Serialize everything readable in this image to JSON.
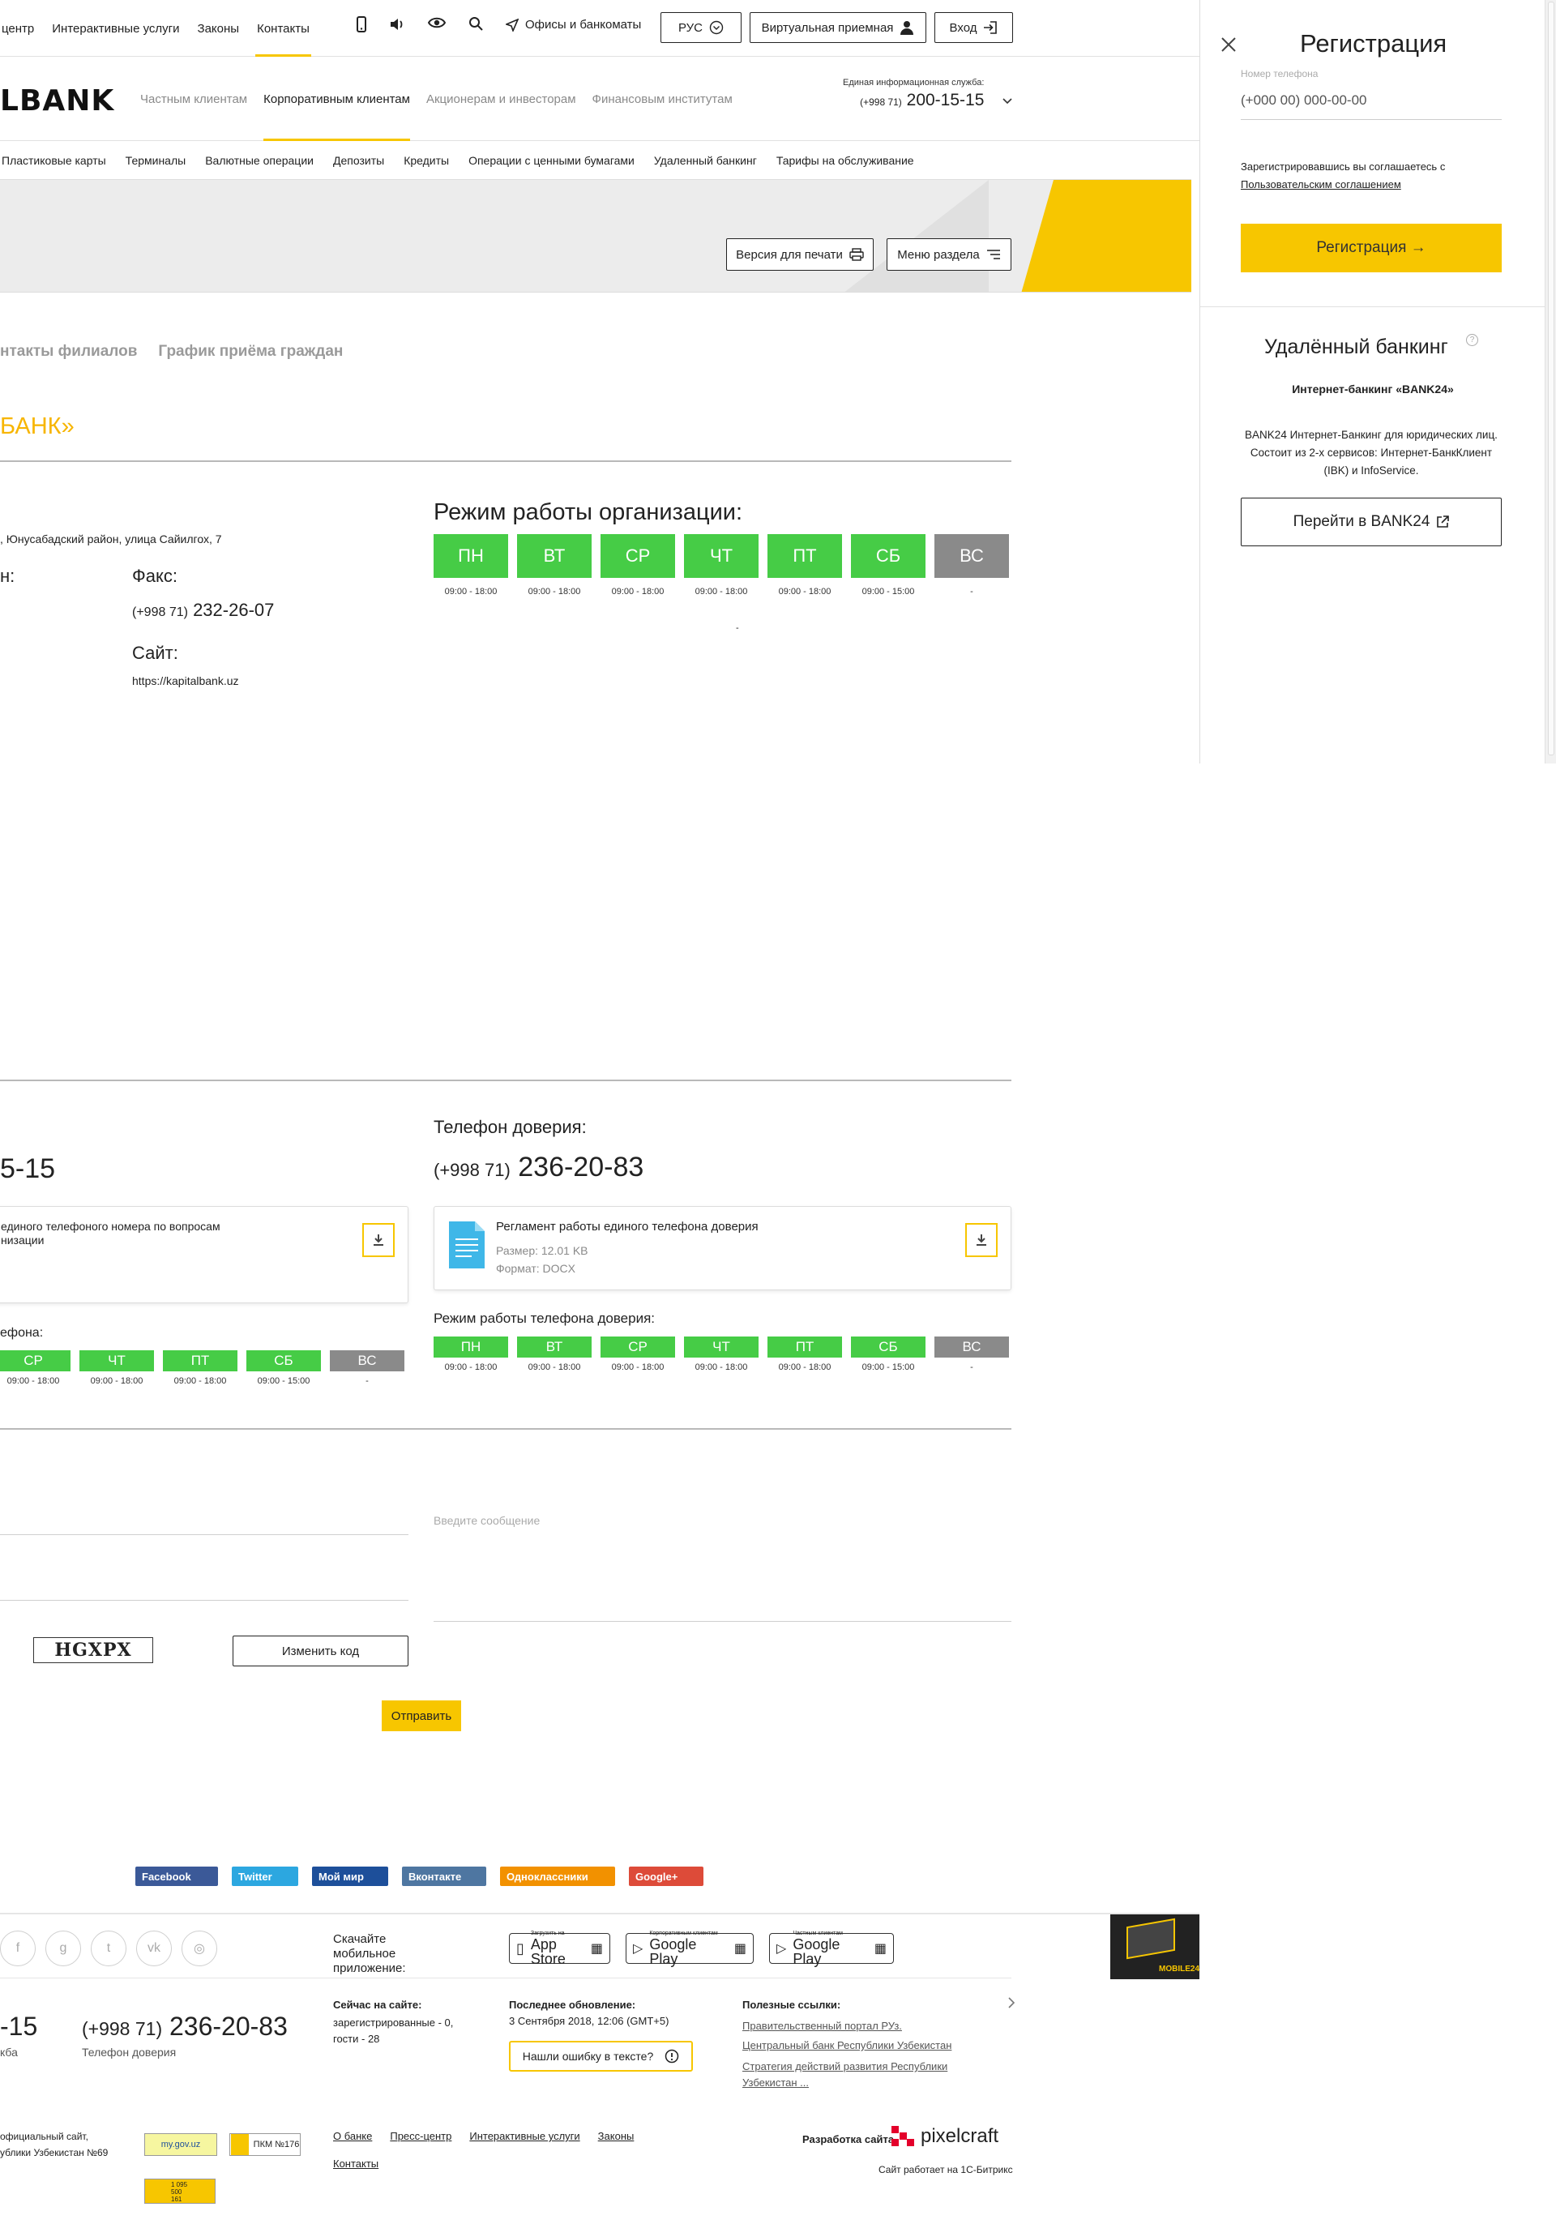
{
  "topbar": {
    "links": [
      "центр",
      "Интерактивные услуги",
      "Законы",
      "Контакты"
    ],
    "offices": "Офисы и банкоматы",
    "lang": "РУС",
    "virtual": "Виртуальная приемная",
    "login": "Вход"
  },
  "header": {
    "logo": "LBANK",
    "nav": [
      "Частным клиентам",
      "Корпоративным клиентам",
      "Акционерам и инвесторам",
      "Финансовым институтам"
    ],
    "helpline_label": "Единая информационная служба:",
    "helpline_code": "(+998 71)",
    "helpline_number": "200-15-15"
  },
  "subnav": [
    "Пластиковые карты",
    "Терминалы",
    "Валютные операции",
    "Депозиты",
    "Кредиты",
    "Операции с ценными бумагами",
    "Удаленный банкинг",
    "Тарифы на обслуживание"
  ],
  "banner": {
    "print": "Версия для печати",
    "menu": "Меню раздела"
  },
  "tabs": [
    "нтакты филиалов",
    "График приёма граждан"
  ],
  "page_title": "БАНК»",
  "contacts": {
    "address": ", Юнусабадский район, улица Сайилгох, 7",
    "phone_label": "н:",
    "fax_label": "Факс:",
    "fax_code": "(+998 71)",
    "fax_number": "232-26-07",
    "site_label": "Сайт:",
    "site_value": "https://kapitalbank.uz"
  },
  "schedule": {
    "title": "Режим работы организации:",
    "days": [
      {
        "d": "ПН",
        "t": "09:00 - 18:00"
      },
      {
        "d": "ВТ",
        "t": "09:00 - 18:00"
      },
      {
        "d": "СР",
        "t": "09:00 - 18:00"
      },
      {
        "d": "ЧТ",
        "t": "09:00 - 18:00"
      },
      {
        "d": "ПТ",
        "t": "09:00 - 18:00"
      },
      {
        "d": "СБ",
        "t": "09:00 - 15:00"
      },
      {
        "d": "ВС",
        "t": "-"
      }
    ],
    "note": "-"
  },
  "single": {
    "number": "5-15",
    "doc_title_1": "единого телефоного номера по вопросам",
    "doc_title_2": "низации",
    "sched_label": "ефона:",
    "days": [
      {
        "d": "СР",
        "t": "09:00 - 18:00"
      },
      {
        "d": "ЧТ",
        "t": "09:00 - 18:00"
      },
      {
        "d": "ПТ",
        "t": "09:00 - 18:00"
      },
      {
        "d": "СБ",
        "t": "09:00 - 15:00"
      },
      {
        "d": "ВС",
        "t": "-"
      }
    ]
  },
  "trust": {
    "label": "Телефон доверия:",
    "code": "(+998 71)",
    "number": "236-20-83",
    "doc_title": "Регламент работы единого телефона доверия",
    "doc_size": "Размер: 12.01 KB",
    "doc_format": "Формат: DOCX",
    "sched_label": "Режим работы телефона доверия:",
    "days": [
      {
        "d": "ПН",
        "t": "09:00 - 18:00"
      },
      {
        "d": "ВТ",
        "t": "09:00 - 18:00"
      },
      {
        "d": "СР",
        "t": "09:00 - 18:00"
      },
      {
        "d": "ЧТ",
        "t": "09:00 - 18:00"
      },
      {
        "d": "ПТ",
        "t": "09:00 - 18:00"
      },
      {
        "d": "СБ",
        "t": "09:00 - 15:00"
      },
      {
        "d": "ВС",
        "t": "-"
      }
    ]
  },
  "form": {
    "message_placeholder": "Введите сообщение",
    "captcha": "HGXPX",
    "change_code": "Изменить код",
    "submit": "Отправить"
  },
  "share": [
    "Facebook",
    "Twitter",
    "Мой мир",
    "Вконтакте",
    "Одноклассники",
    "Google+"
  ],
  "footer": {
    "app_label": "Скачайте мобильное приложение:",
    "stores": [
      {
        "small": "Загрузить на",
        "big": "App Store"
      },
      {
        "small": "Корпоративным клиентам",
        "big": "Google Play"
      },
      {
        "small": "Частным клиентам",
        "big": "Google Play"
      }
    ],
    "mobile_badge": "MOBILE24",
    "num1": "-15",
    "num1_label": "кба",
    "num2_code": "(+998 71)",
    "num2": "236-20-83",
    "num2_label": "Телефон доверия",
    "online_title": "Сейчас на сайте:",
    "online_text": "зарегистрированные - 0, гости - 28",
    "update_title": "Последнее обновление:",
    "update_text": "3 Сентября 2018, 12:06 (GMT+5)",
    "error_btn": "Нашли ошибку в тексте?",
    "useful_title": "Полезные ссылки:",
    "useful": [
      "Правительственный портал РУз.",
      "Центральный банк Республики Узбекистан",
      "Стратегия действий развития Республики Узбекистан ..."
    ],
    "official_1": "официальный сайт,",
    "official_2": "ублики Узбекистан №69",
    "gov_badge": "my.gov.uz",
    "pkm_badge": "ПКМ №176",
    "links": [
      "О банке",
      "Пресс-центр",
      "Интерактивные услуги",
      "Законы",
      "Контакты"
    ],
    "dev_label": "Разработка сайта",
    "dev_brand": "pixelcraft",
    "bitrix": "Сайт работает на 1С-Битрикс",
    "counter": [
      "1 095",
      "500",
      "161"
    ]
  },
  "panel": {
    "title": "Регистрация",
    "phone_label": "Номер телефона",
    "phone_placeholder": "(+000 00) 000-00-00",
    "agree_text": "Зарегистрировавшись вы соглашаетесь с",
    "agree_link": "Пользовательским соглашением",
    "register_btn": "Регистрация →",
    "remote_title": "Удалённый банкинг",
    "remote_sub": "Интернет-банкинг «BANK24»",
    "remote_desc": "BANK24 Интернет-Банкинг для юридических лиц. Состоит из 2-х сервисов: Интернет-БанкКлиент (IBK) и InfoService.",
    "remote_btn": "Перейти в BANK24"
  },
  "colors": {
    "accent": "#f7c600",
    "green": "#46cc46",
    "off": "#8a8a8a"
  }
}
